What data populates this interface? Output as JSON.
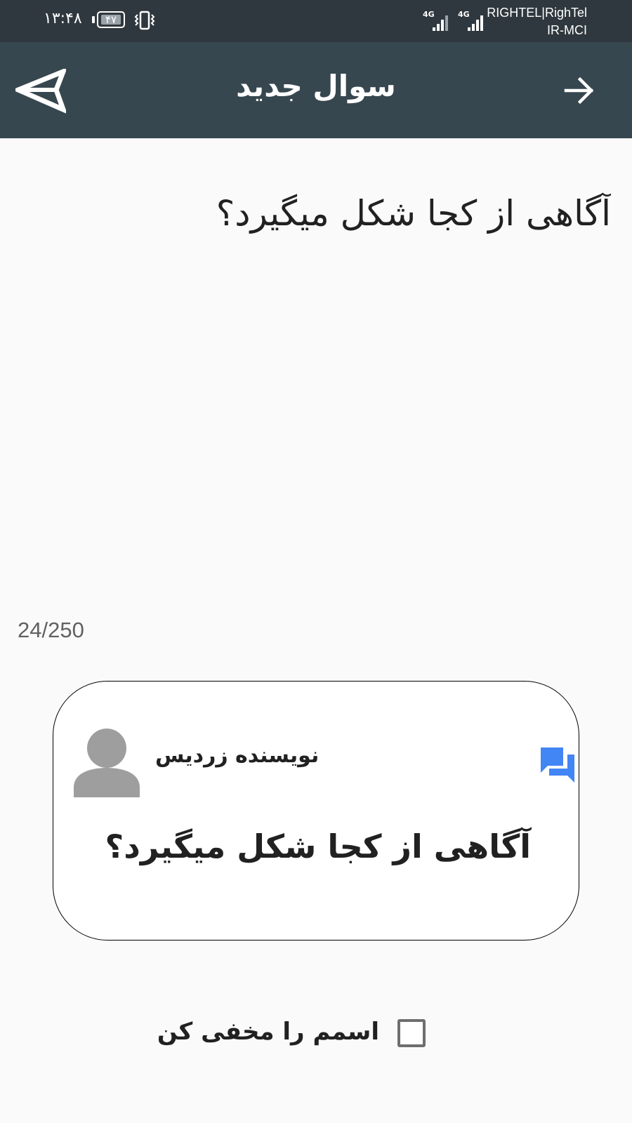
{
  "status_bar": {
    "time": "۱۳:۴۸",
    "battery": "۴۷",
    "carrier_line1": "RIGHTEL|RighTel",
    "carrier_line2": "IR-MCI",
    "network_label": "4G",
    "icons": [
      "vibrate-icon",
      "signal-icon",
      "signal-icon",
      "battery-icon"
    ]
  },
  "app_bar": {
    "title": "سوال جدید",
    "send_icon": "send-icon",
    "back_icon": "arrow-right-icon"
  },
  "question": {
    "value": "آگاهی از کجا شکل میگیرد؟",
    "char_count": "24/250"
  },
  "preview_card": {
    "author": "نویسنده زردیس",
    "question_text": "آگاهی از کجا شکل میگیرد؟",
    "avatar_icon": "person-icon",
    "forum_icon": "forum-icon"
  },
  "hide_name": {
    "label": "اسمم را مخفی کن",
    "checked": false
  },
  "colors": {
    "status_bar": "#2f383e",
    "app_bar": "#37474f",
    "background": "#fafafa",
    "accent_blue": "#4285f4",
    "avatar_gray": "#9e9e9e"
  }
}
